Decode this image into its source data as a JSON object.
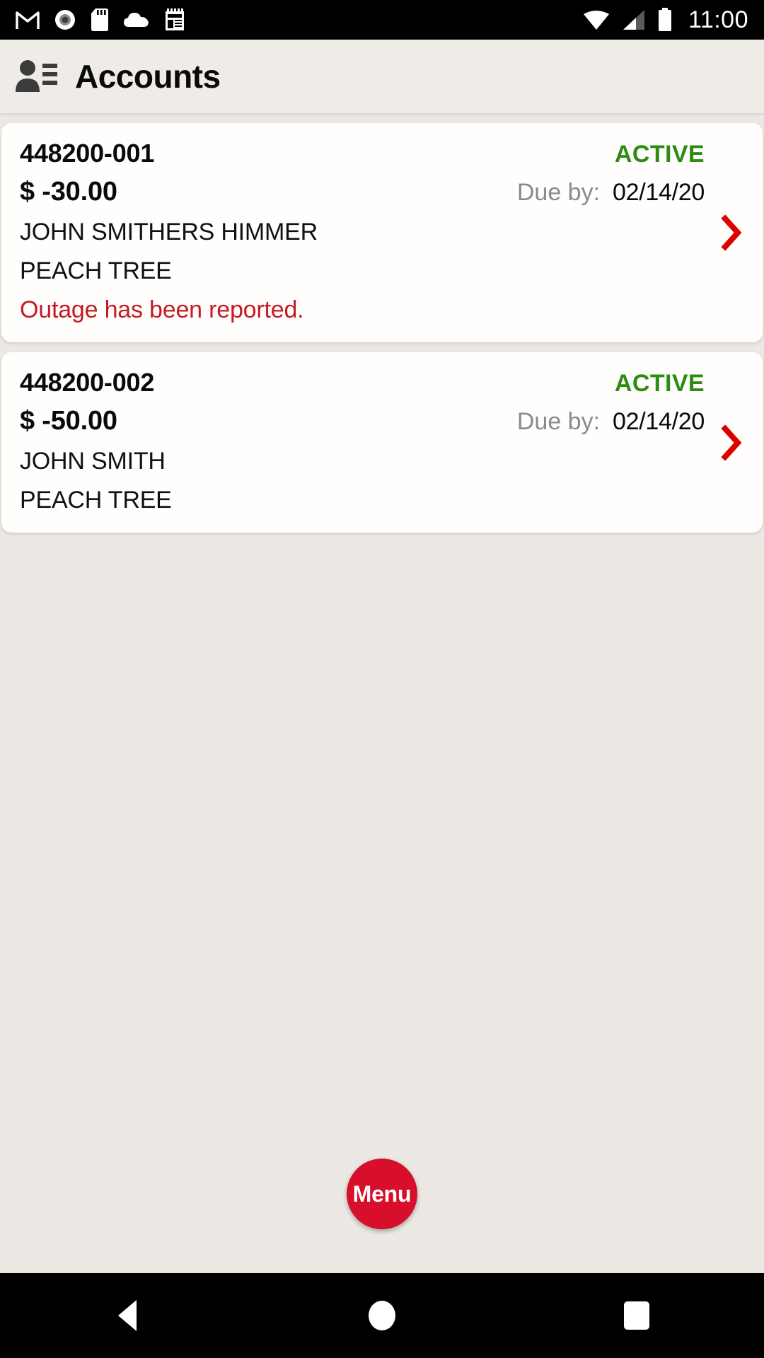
{
  "status_bar": {
    "time": "11:00",
    "left_icons": [
      "gmail-icon",
      "record-circle-icon",
      "sd-card-icon",
      "cloud-icon",
      "notepad-icon"
    ],
    "right_icons": [
      "wifi-icon",
      "cellular-signal-icon",
      "battery-icon"
    ]
  },
  "app_bar": {
    "title": "Accounts",
    "icon": "contacts-icon"
  },
  "colors": {
    "background": "#ece9e4",
    "card": "#fffefd",
    "status_active": "#2e8b13",
    "alert_red": "#c41b22",
    "chevron_red": "#dd0000",
    "fab_red": "#d80f2a"
  },
  "accounts": [
    {
      "account_number": "448200-001",
      "status": "ACTIVE",
      "amount": "$ -30.00",
      "due_label": "Due by:",
      "due_date": "02/14/20",
      "customer_name": "JOHN SMITHERS HIMMER",
      "address": "PEACH TREE",
      "alert": "Outage has been reported."
    },
    {
      "account_number": "448200-002",
      "status": "ACTIVE",
      "amount": "$ -50.00",
      "due_label": "Due by:",
      "due_date": "02/14/20",
      "customer_name": "JOHN SMITH",
      "address": "PEACH TREE",
      "alert": ""
    }
  ],
  "fab": {
    "label": "Menu"
  },
  "nav_bar": {
    "back": "back-button",
    "home": "home-button",
    "recents": "recents-button"
  }
}
